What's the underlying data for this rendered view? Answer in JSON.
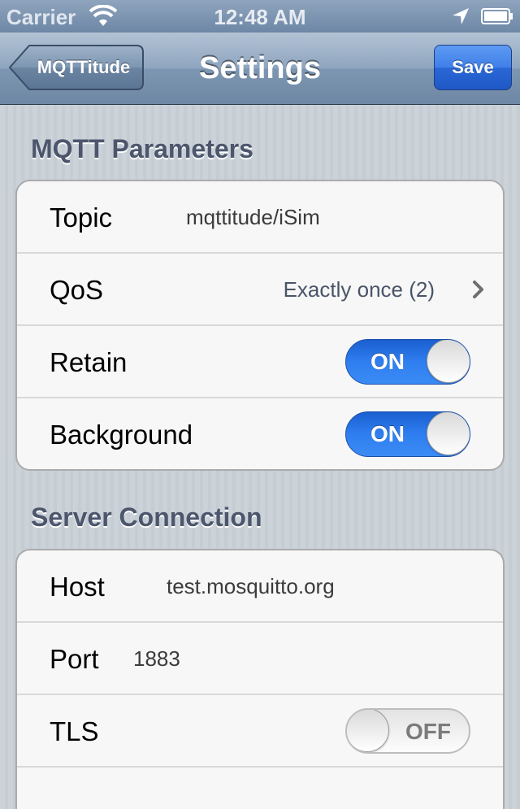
{
  "status_bar": {
    "carrier": "Carrier",
    "time": "12:48 AM",
    "icons": [
      "wifi-icon",
      "location-icon",
      "battery-icon"
    ]
  },
  "nav": {
    "back_label": "MQTTitude",
    "title": "Settings",
    "save_label": "Save"
  },
  "sections": [
    {
      "header": "MQTT Parameters",
      "rows": [
        {
          "label": "Topic",
          "value": "mqttitude/iSim"
        },
        {
          "label": "QoS",
          "detail": "Exactly once (2)"
        },
        {
          "label": "Retain",
          "switch": "ON"
        },
        {
          "label": "Background",
          "switch": "ON"
        }
      ]
    },
    {
      "header": "Server Connection",
      "rows": [
        {
          "label": "Host",
          "value": "test.mosquitto.org"
        },
        {
          "label": "Port",
          "value": "1883"
        },
        {
          "label": "TLS",
          "switch": "OFF"
        }
      ]
    }
  ],
  "colors": {
    "navbar": "#7d96b2",
    "save_button": "#2a67d6",
    "switch_on": "#2f7ef0"
  }
}
